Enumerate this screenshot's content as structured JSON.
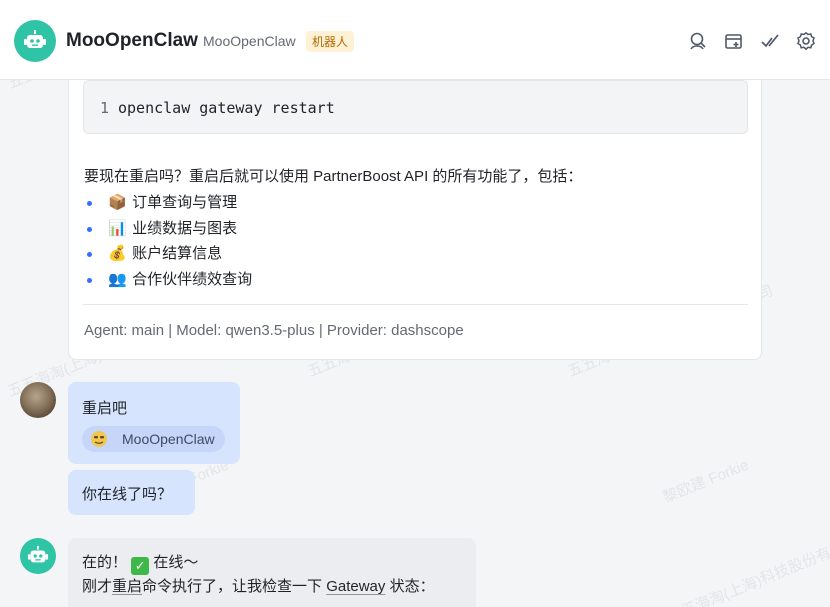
{
  "header": {
    "title": "MooOpenClaw",
    "subtitle": "MooOpenClaw",
    "badge": "机器人",
    "icons": [
      "search-person-icon",
      "add-tab-icon",
      "check-edit-icon",
      "gear-icon"
    ]
  },
  "message_bot_1": {
    "code": {
      "line_number": "1",
      "text": "openclaw gateway restart"
    },
    "paragraph": "要现在重启吗？重启后就可以使用 PartnerBoost API 的所有功能了，包括：",
    "features": [
      {
        "emoji": "📦",
        "label": "订单查询与管理"
      },
      {
        "emoji": "📊",
        "label": "业绩数据与图表"
      },
      {
        "emoji": "💰",
        "label": "账户结算信息"
      },
      {
        "emoji": "👥",
        "label": "合作伙伴绩效查询"
      }
    ],
    "meta": "Agent: main | Model: qwen3.5-plus | Provider: dashscope"
  },
  "message_user_1": {
    "text": "重启吧",
    "mention": "MooOpenClaw"
  },
  "message_user_2": {
    "text": "你在线了吗？"
  },
  "message_bot_2": {
    "line1_prefix": "在的！",
    "line1_check": "✓",
    "line1_suffix": "在线～",
    "line2_a": "刚才",
    "line2_b": "重启",
    "line2_c": "命令执行了，让我检查一下 ",
    "line2_d": "Gateway",
    "line2_e": " 状态："
  },
  "watermarks": [
    "五五海淘(上海)科技股份有限公司",
    "黎欧建 Forkie"
  ],
  "colors": {
    "bot_teal": "#2ec4a5",
    "user_bubble": "#d6e4fd",
    "bullet_blue": "#3370ff",
    "badge_bg": "#fff1d6"
  }
}
